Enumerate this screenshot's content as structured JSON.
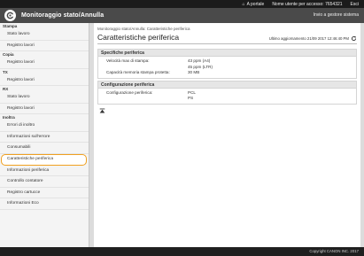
{
  "topbar": {
    "portal_label": "A portale",
    "user_label": "Nome utente per accesso:",
    "user_value": "7654321",
    "logout_label": "Esci"
  },
  "titlebar": {
    "title": "Monitoraggio stato/Annulla",
    "admin_link": "Invio a gestore sistema"
  },
  "sidebar": {
    "sections": [
      {
        "heading": "Stampa",
        "items": [
          "Stato lavoro",
          "Registro lavori"
        ]
      },
      {
        "heading": "Copia",
        "items": [
          "Registro lavori"
        ]
      },
      {
        "heading": "TX",
        "items": [
          "Registro lavori"
        ]
      },
      {
        "heading": "RX",
        "items": [
          "Stato lavoro",
          "Registro lavori"
        ]
      },
      {
        "heading": "Inoltra",
        "items": [
          "Errori di inoltro",
          "Informazioni sull'errore",
          "Consumabili",
          "Caratteristiche periferica",
          "Informazioni periferica",
          "Controllo contatore",
          "Registro cartucce",
          "Informazioni Eco"
        ]
      }
    ],
    "selected": "Caratteristiche periferica"
  },
  "content": {
    "breadcrumb": "Monitoraggio stato/Annulla: Caratteristiche periferica",
    "title": "Caratteristiche periferica",
    "updated": "Ultimo aggiornamento 21/09 2017 12:46:40 PM",
    "panels": [
      {
        "heading": "Specifiche periferica",
        "rows": [
          {
            "label": "Velocità max di stampa:",
            "values": [
              "43 ppm (A4)",
              "45 ppm (LTR)"
            ]
          },
          {
            "label": "Capacità memoria stampa protetta:",
            "values": [
              "30 MB"
            ]
          }
        ]
      },
      {
        "heading": "Configurazione periferica",
        "rows": [
          {
            "label": "Configurazione periferica:",
            "values": [
              "PCL",
              "PS"
            ]
          }
        ]
      }
    ]
  },
  "footer": {
    "copyright": "Copyright CANON INC. 2017"
  },
  "colors": {
    "selected_outline": "#f0a020",
    "topbar_bg": "#1b1b1b",
    "titlebar_bg": "#4a4a4a"
  },
  "icons": {
    "logo": "canon-logo-icon",
    "refresh": "refresh-icon",
    "top": "back-to-top-icon",
    "home": "home-icon"
  }
}
